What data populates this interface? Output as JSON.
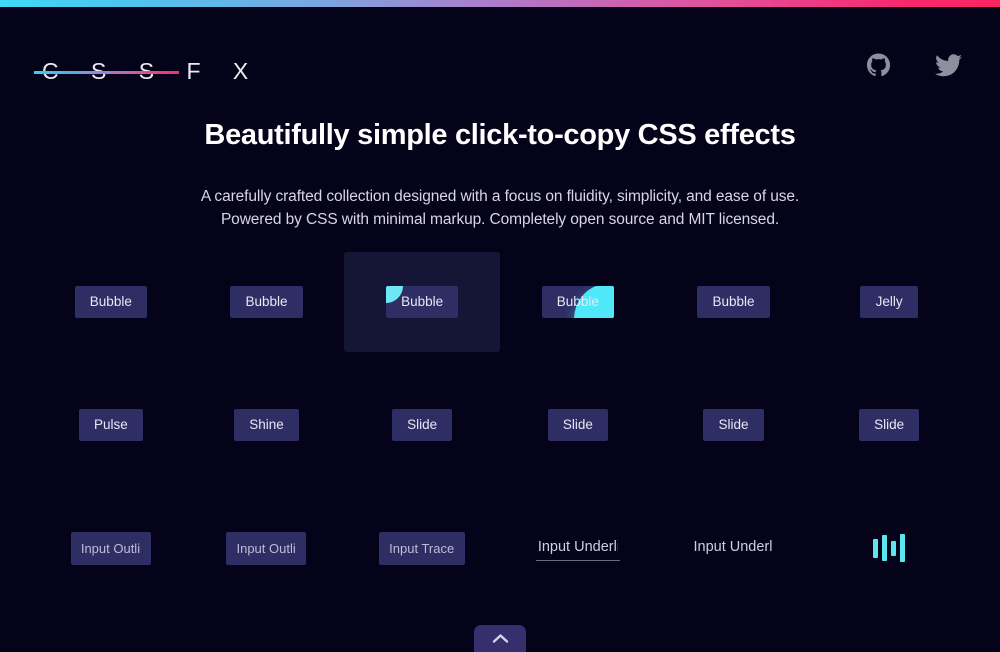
{
  "theme": {
    "background": "#05031a",
    "button_bg": "#2e2d64",
    "accent_cyan": "#4fe8f8",
    "accent_pink": "#f52f5f",
    "hover_card_bg": "#151536"
  },
  "topbar": {
    "gradient_from": "#3fd9f5",
    "gradient_to": "#fb2462"
  },
  "header": {
    "logo_text": "C S S F X",
    "social": [
      {
        "name": "github-icon",
        "label": "GitHub"
      },
      {
        "name": "twitter-icon",
        "label": "Twitter"
      }
    ]
  },
  "hero": {
    "title": "Beautifully simple click-to-copy CSS effects",
    "subtitle_line1": "A carefully crafted collection designed with a focus on fluidity, simplicity, and ease of use.",
    "subtitle_line2": "Powered by CSS with minimal markup. Completely open source and MIT licensed."
  },
  "grid": {
    "rows": [
      {
        "cells": [
          {
            "type": "button",
            "label": "Bubble",
            "state": "idle"
          },
          {
            "type": "button",
            "label": "Bubble",
            "state": "idle"
          },
          {
            "type": "button",
            "label": "Bubble",
            "state": "hovered",
            "effect": "bubble-small"
          },
          {
            "type": "button",
            "label": "Bubble",
            "state": "active",
            "effect": "bubble-large"
          },
          {
            "type": "button",
            "label": "Bubble",
            "state": "idle"
          },
          {
            "type": "button",
            "label": "Jelly",
            "state": "idle"
          }
        ]
      },
      {
        "cells": [
          {
            "type": "button",
            "label": "Pulse",
            "state": "idle"
          },
          {
            "type": "button",
            "label": "Shine",
            "state": "idle"
          },
          {
            "type": "button",
            "label": "Slide",
            "state": "idle"
          },
          {
            "type": "button",
            "label": "Slide",
            "state": "idle"
          },
          {
            "type": "button",
            "label": "Slide",
            "state": "idle"
          },
          {
            "type": "button",
            "label": "Slide",
            "state": "idle"
          }
        ]
      },
      {
        "cells": [
          {
            "type": "input",
            "placeholder": "Input Outline",
            "style": "filled"
          },
          {
            "type": "input",
            "placeholder": "Input Outline",
            "style": "filled"
          },
          {
            "type": "input",
            "placeholder": "Input Trace",
            "style": "filled"
          },
          {
            "type": "input",
            "placeholder": "Input Underlin",
            "style": "underline"
          },
          {
            "type": "input",
            "placeholder": "Input Underlin",
            "style": "plain"
          },
          {
            "type": "loader",
            "label": "Loader",
            "bars": 4
          }
        ]
      }
    ]
  },
  "footer": {
    "scroll_top_label": "Scroll to top",
    "scroll_top_icon": "chevron-up-icon"
  }
}
